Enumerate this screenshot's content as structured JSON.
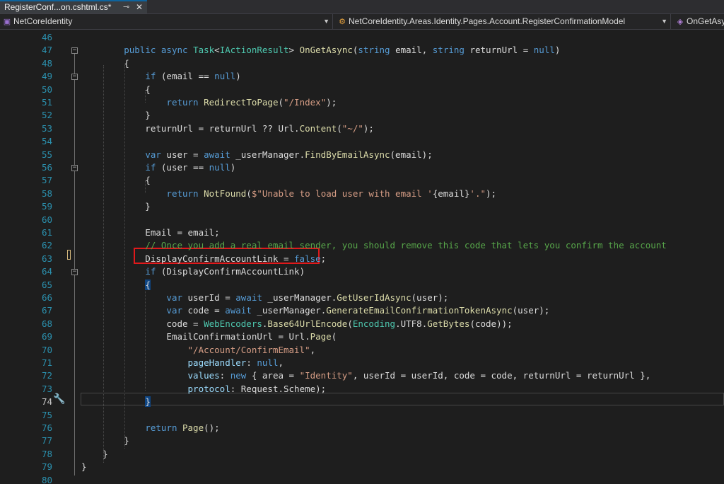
{
  "tab": {
    "title": "RegisterConf...on.cshtml.cs*",
    "pin_glyph": "⊸",
    "close_glyph": "✕"
  },
  "nav": {
    "project": "NetCoreIdentity",
    "type": "NetCoreIdentity.Areas.Identity.Pages.Account.RegisterConfirmationModel",
    "member": "OnGetAsy"
  },
  "icons": {
    "project": "csharp-project-icon",
    "type": "class-icon",
    "member": "method-icon",
    "quick_action": "screwdriver-icon"
  },
  "colors": {
    "keyword": "#569cd6",
    "type": "#4ec9b0",
    "string": "#d69d85",
    "comment": "#57a64a",
    "method": "#dcdcaa",
    "highlight_box": "#e0191b"
  },
  "lines": [
    {
      "n": "46",
      "html": ""
    },
    {
      "n": "47",
      "html": "        <span class=\"k\">public async</span> <span class=\"t\">Task</span>&lt;<span class=\"t\">IActionResult</span>&gt; <span class=\"m\">OnGetAsync</span>(<span class=\"k\">string</span> email, <span class=\"k\">string</span> returnUrl = <span class=\"k\">null</span>)"
    },
    {
      "n": "48",
      "html": "        {"
    },
    {
      "n": "49",
      "html": "            <span class=\"k\">if</span> (email == <span class=\"k\">null</span>)"
    },
    {
      "n": "50",
      "html": "            {"
    },
    {
      "n": "51",
      "html": "                <span class=\"k\">return</span> <span class=\"m\">RedirectToPage</span>(<span class=\"s\">\"/Index\"</span>);"
    },
    {
      "n": "52",
      "html": "            }"
    },
    {
      "n": "53",
      "html": "            returnUrl = returnUrl ?? Url.<span class=\"m\">Content</span>(<span class=\"s\">\"~/\"</span>);"
    },
    {
      "n": "54",
      "html": ""
    },
    {
      "n": "55",
      "html": "            <span class=\"k\">var</span> user = <span class=\"k\">await</span> _userManager.<span class=\"m\">FindByEmailAsync</span>(email);"
    },
    {
      "n": "56",
      "html": "            <span class=\"k\">if</span> (user == <span class=\"k\">null</span>)"
    },
    {
      "n": "57",
      "html": "            {"
    },
    {
      "n": "58",
      "html": "                <span class=\"k\">return</span> <span class=\"m\">NotFound</span>(<span class=\"s\">$\"Unable to load user with email '</span>{email}<span class=\"s\">'.\"</span>);"
    },
    {
      "n": "59",
      "html": "            }"
    },
    {
      "n": "60",
      "html": ""
    },
    {
      "n": "61",
      "html": "            Email = email;"
    },
    {
      "n": "62",
      "html": "            <span class=\"c\">// Once you add a real email sender, you should remove this code that lets you confirm the account</span>"
    },
    {
      "n": "63",
      "html": "            DisplayConfirmAccountLink = <span class=\"k\">false</span>;"
    },
    {
      "n": "64",
      "html": "            <span class=\"k\">if</span> (DisplayConfirmAccountLink)"
    },
    {
      "n": "65",
      "html": "            <span class=\"brace-hl\">{</span>"
    },
    {
      "n": "66",
      "html": "                <span class=\"k\">var</span> userId = <span class=\"k\">await</span> _userManager.<span class=\"m\">GetUserIdAsync</span>(user);"
    },
    {
      "n": "67",
      "html": "                <span class=\"k\">var</span> code = <span class=\"k\">await</span> _userManager.<span class=\"m\">GenerateEmailConfirmationTokenAsync</span>(user);"
    },
    {
      "n": "68",
      "html": "                code = <span class=\"t\">WebEncoders</span>.<span class=\"m\">Base64UrlEncode</span>(<span class=\"t\">Encoding</span>.UTF8.<span class=\"m\">GetBytes</span>(code));"
    },
    {
      "n": "69",
      "html": "                EmailConfirmationUrl = Url.<span class=\"m\">Page</span>("
    },
    {
      "n": "70",
      "html": "                    <span class=\"s\">\"/Account/ConfirmEmail\"</span>,"
    },
    {
      "n": "71",
      "html": "                    <span class=\"p\">pageHandler</span>: <span class=\"k\">null</span>,"
    },
    {
      "n": "72",
      "html": "                    <span class=\"p\">values</span>: <span class=\"k\">new</span> { area = <span class=\"s\">\"Identity\"</span>, userId = userId, code = code, returnUrl = returnUrl },"
    },
    {
      "n": "73",
      "html": "                    <span class=\"p\">protocol</span>: Request.Scheme);"
    },
    {
      "n": "74",
      "html": "            <span class=\"brace-hl\">}</span>"
    },
    {
      "n": "75",
      "html": ""
    },
    {
      "n": "76",
      "html": "            <span class=\"k\">return</span> <span class=\"m\">Page</span>();"
    },
    {
      "n": "77",
      "html": "        }"
    },
    {
      "n": "78",
      "html": "    }"
    },
    {
      "n": "79",
      "html": "}"
    },
    {
      "n": "80",
      "html": ""
    }
  ],
  "fold_lines": [
    "47",
    "49",
    "56",
    "64"
  ],
  "current_line": "74"
}
